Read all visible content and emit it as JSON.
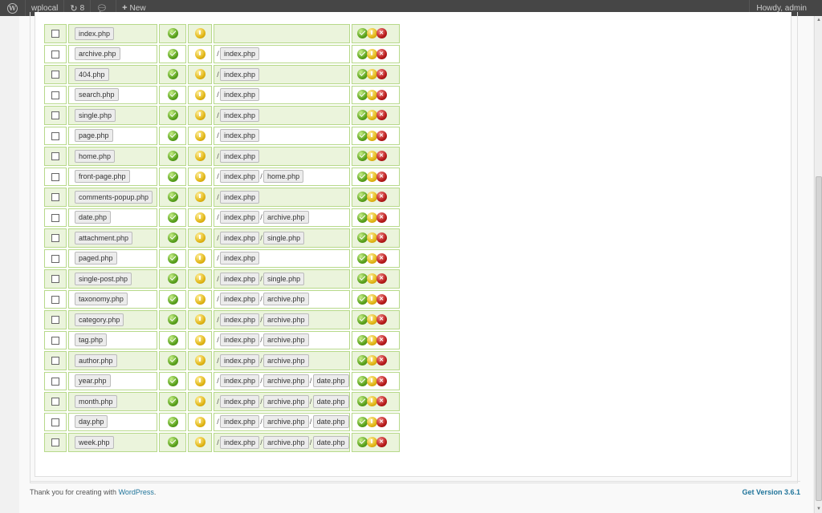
{
  "adminbar": {
    "site_name": "wplocal",
    "updates_count": "8",
    "new_label": "New",
    "howdy": "Howdy, admin"
  },
  "rows": [
    {
      "file": "index.php",
      "chain": []
    },
    {
      "file": "archive.php",
      "chain": [
        "index.php"
      ]
    },
    {
      "file": "404.php",
      "chain": [
        "index.php"
      ]
    },
    {
      "file": "search.php",
      "chain": [
        "index.php"
      ]
    },
    {
      "file": "single.php",
      "chain": [
        "index.php"
      ]
    },
    {
      "file": "page.php",
      "chain": [
        "index.php"
      ]
    },
    {
      "file": "home.php",
      "chain": [
        "index.php"
      ]
    },
    {
      "file": "front-page.php",
      "chain": [
        "index.php",
        "home.php"
      ]
    },
    {
      "file": "comments-popup.php",
      "chain": [
        "index.php"
      ]
    },
    {
      "file": "date.php",
      "chain": [
        "index.php",
        "archive.php"
      ]
    },
    {
      "file": "attachment.php",
      "chain": [
        "index.php",
        "single.php"
      ]
    },
    {
      "file": "paged.php",
      "chain": [
        "index.php"
      ]
    },
    {
      "file": "single-post.php",
      "chain": [
        "index.php",
        "single.php"
      ]
    },
    {
      "file": "taxonomy.php",
      "chain": [
        "index.php",
        "archive.php"
      ]
    },
    {
      "file": "category.php",
      "chain": [
        "index.php",
        "archive.php"
      ]
    },
    {
      "file": "tag.php",
      "chain": [
        "index.php",
        "archive.php"
      ]
    },
    {
      "file": "author.php",
      "chain": [
        "index.php",
        "archive.php"
      ]
    },
    {
      "file": "year.php",
      "chain": [
        "index.php",
        "archive.php",
        "date.php"
      ]
    },
    {
      "file": "month.php",
      "chain": [
        "index.php",
        "archive.php",
        "date.php"
      ]
    },
    {
      "file": "day.php",
      "chain": [
        "index.php",
        "archive.php",
        "date.php"
      ]
    },
    {
      "file": "week.php",
      "chain": [
        "index.php",
        "archive.php",
        "date.php"
      ]
    }
  ],
  "chain_separator": "/",
  "footer": {
    "thanks_prefix": "Thank you for creating with ",
    "wordpress_link": "WordPress",
    "thanks_suffix": ".",
    "version_link": "Get Version 3.6.1"
  },
  "colors": {
    "row_alt": "#ebf4dc",
    "cell_border": "#b7d98a",
    "link": "#21759b",
    "adminbar": "#464646"
  }
}
